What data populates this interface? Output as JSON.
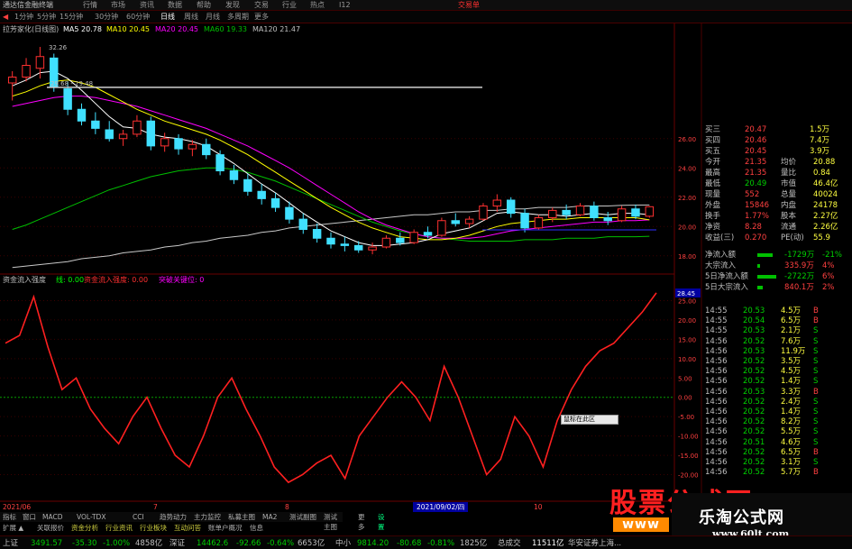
{
  "menubar": {
    "items": [
      "通达信金融终端",
      "行情",
      "市场",
      "资讯",
      "数据",
      "帮助",
      "发现",
      "交易",
      "行业",
      "热点",
      "I12"
    ],
    "trade_button": "交易单",
    "colors": {
      "accent": "#ff2020"
    }
  },
  "toolbar": {
    "period_tabs": [
      "1分钟",
      "5分钟",
      "15分钟",
      "30分钟",
      "60分钟",
      "日线",
      "周线",
      "月线",
      "多周期",
      "更多"
    ],
    "active_period": "日线",
    "icons": [
      "back-icon",
      "refresh-icon"
    ]
  },
  "ma_legend": {
    "stock": "拉芳家化(日线图)",
    "ma5": "MA5 20.78",
    "ma10": "MA10 20.45",
    "ma20": "MA20 20.45",
    "ma60": "MA60 19.33",
    "ma120": "MA120 21.47",
    "colors": {
      "ma5": "#ffffff",
      "ma10": "#ffff00",
      "ma20": "#ff00ff",
      "ma60": "#00c000",
      "ma120": "#c0c0c0"
    }
  },
  "annotations": {
    "high": "32.26",
    "line_label": "29.68 - 29.48",
    "low_right": "28.45"
  },
  "fund_legend": {
    "title": "资金流入强度",
    "value_label": "线: 0.00",
    "signal_label": "资金流入强度: 0.00",
    "extra_label": "突破关键位: 0"
  },
  "quote_panel": {
    "rows": [
      {
        "label": "买三",
        "price": "20.47",
        "vol": "1.5万"
      },
      {
        "label": "买四",
        "price": "20.46",
        "vol": "7.4万"
      },
      {
        "label": "买五",
        "price": "20.45",
        "vol": "3.9万"
      },
      {
        "label": "今开",
        "price": "21.35",
        "label2": "均价",
        "value2": "20.88"
      },
      {
        "label": "最高",
        "price": "21.35",
        "label2": "量比",
        "value2": "0.84"
      },
      {
        "label": "最低",
        "price": "20.49",
        "label2": "市值",
        "value2": "46.4亿"
      },
      {
        "label": "现量",
        "price": "552",
        "label2": "总量",
        "value2": "40024"
      },
      {
        "label": "外盘",
        "price": "15846",
        "label2": "内盘",
        "value2": "24178"
      },
      {
        "label": "换手",
        "price": "1.77%",
        "label2": "股本",
        "value2": "2.27亿"
      },
      {
        "label": "净资",
        "price": "8.28",
        "label2": "流通",
        "value2": "2.26亿"
      },
      {
        "label": "收益(三)",
        "price": "0.270",
        "label2": "PE(动)",
        "value2": "55.9"
      }
    ]
  },
  "flow_panel": {
    "rows": [
      {
        "label": "净流入额",
        "value": "-1729万",
        "pct": "-21%",
        "level": 0.55
      },
      {
        "label": "大宗流入",
        "value": "335.9万",
        "pct": "4%",
        "level": 0.1
      },
      {
        "label": "5日净流入额",
        "value": "-2722万",
        "pct": "6%",
        "level": 0.7
      },
      {
        "label": "5日大宗流入",
        "value": "840.1万",
        "pct": "2%",
        "level": 0.2
      }
    ]
  },
  "ticks": [
    {
      "time": "14:55",
      "price": "20.53",
      "vol": "4.5万",
      "side": "B"
    },
    {
      "time": "14:55",
      "price": "20.54",
      "vol": "6.5万",
      "side": "B"
    },
    {
      "time": "14:55",
      "price": "20.53",
      "vol": "2.1万",
      "side": "S"
    },
    {
      "time": "14:56",
      "price": "20.52",
      "vol": "7.6万",
      "side": "S"
    },
    {
      "time": "14:56",
      "price": "20.53",
      "vol": "11.9万",
      "side": "S"
    },
    {
      "time": "14:56",
      "price": "20.52",
      "vol": "3.5万",
      "side": "S"
    },
    {
      "time": "14:56",
      "price": "20.52",
      "vol": "4.5万",
      "side": "S"
    },
    {
      "time": "14:56",
      "price": "20.52",
      "vol": "1.4万",
      "side": "S"
    },
    {
      "time": "14:56",
      "price": "20.53",
      "vol": "3.3万",
      "side": "B"
    },
    {
      "time": "14:56",
      "price": "20.52",
      "vol": "2.4万",
      "side": "S"
    },
    {
      "time": "14:56",
      "price": "20.52",
      "vol": "1.4万",
      "side": "S"
    },
    {
      "time": "14:56",
      "price": "20.52",
      "vol": "8.2万",
      "side": "S"
    },
    {
      "time": "14:56",
      "price": "20.52",
      "vol": "5.5万",
      "side": "S"
    },
    {
      "time": "14:56",
      "price": "20.51",
      "vol": "4.6万",
      "side": "S"
    },
    {
      "time": "14:56",
      "price": "20.52",
      "vol": "6.5万",
      "side": "B"
    },
    {
      "time": "14:56",
      "price": "20.52",
      "vol": "3.1万",
      "side": "S"
    },
    {
      "time": "14:56",
      "price": "20.52",
      "vol": "5.7万",
      "side": "B"
    }
  ],
  "axis": {
    "main_ticks": [
      "26.00",
      "24.00",
      "22.00",
      "20.00",
      "18.00"
    ],
    "ind_ticks": [
      "25.00",
      "20.00",
      "15.00",
      "10.00",
      "5.00",
      "0.00",
      "-5.00",
      "-10.00",
      "-15.00",
      "-20.00"
    ]
  },
  "date_strip": {
    "left": "2021/06",
    "mid_a": "7",
    "mid_b": "8",
    "selected_date": "2021/09/02/四",
    "right": "10"
  },
  "bottom_tabs": [
    "指标",
    "窗口",
    "MACD",
    "VOL-TDX",
    "CCI",
    "趋势动力",
    "主力监控",
    "私募主图",
    "MA2",
    "测试副图",
    "测试主图",
    "更多",
    "设置"
  ],
  "bottom_tabs2": [
    "扩展 ▲",
    "关联报价",
    "资金分析",
    "行业资讯",
    "行业板块",
    "互动问答",
    "账单户概况",
    "信息"
  ],
  "tooltip": "鼠标在此区",
  "status_bar": {
    "items": [
      {
        "label": "上证",
        "value": "3491.57",
        "change": "-35.30",
        "pct": "-1.00%",
        "amount": "4858亿"
      },
      {
        "label": "深证",
        "value": "14462.6",
        "change": "-92.66",
        "pct": "-0.64%",
        "amount": "6653亿"
      },
      {
        "label": "中小",
        "value": "9814.20",
        "change": "-80.68",
        "pct": "-0.81%",
        "amount": "1825亿"
      }
    ],
    "total_label": "总成交",
    "total_value": "11511亿",
    "broker": "华安证券上海..."
  },
  "watermark": {
    "logo_text": "股票公式网",
    "logo_sub": "www",
    "site_name": "乐淘公式网",
    "site_url": "www.60lt.com"
  },
  "chart_data": {
    "type": "line",
    "candles": [
      {
        "o": 29.8,
        "h": 30.6,
        "l": 28.6,
        "c": 30.2
      },
      {
        "o": 30.2,
        "h": 31.5,
        "l": 29.9,
        "c": 31.0
      },
      {
        "o": 30.8,
        "h": 32.26,
        "l": 30.1,
        "c": 31.6
      },
      {
        "o": 31.5,
        "h": 31.8,
        "l": 29.2,
        "c": 29.5
      },
      {
        "o": 29.4,
        "h": 29.9,
        "l": 27.6,
        "c": 28.0
      },
      {
        "o": 28.0,
        "h": 28.4,
        "l": 26.9,
        "c": 27.2
      },
      {
        "o": 27.2,
        "h": 27.8,
        "l": 26.3,
        "c": 26.7
      },
      {
        "o": 26.6,
        "h": 27.2,
        "l": 25.8,
        "c": 26.0
      },
      {
        "o": 26.0,
        "h": 26.6,
        "l": 25.5,
        "c": 26.3
      },
      {
        "o": 26.3,
        "h": 27.6,
        "l": 26.1,
        "c": 27.2
      },
      {
        "o": 27.2,
        "h": 27.5,
        "l": 25.2,
        "c": 25.5
      },
      {
        "o": 25.5,
        "h": 26.4,
        "l": 25.1,
        "c": 26.0
      },
      {
        "o": 26.0,
        "h": 26.3,
        "l": 24.9,
        "c": 25.3
      },
      {
        "o": 25.3,
        "h": 25.9,
        "l": 24.8,
        "c": 25.6
      },
      {
        "o": 25.6,
        "h": 26.0,
        "l": 24.6,
        "c": 24.9
      },
      {
        "o": 24.9,
        "h": 25.2,
        "l": 23.5,
        "c": 23.8
      },
      {
        "o": 23.8,
        "h": 24.2,
        "l": 22.9,
        "c": 23.2
      },
      {
        "o": 23.2,
        "h": 23.6,
        "l": 22.1,
        "c": 22.4
      },
      {
        "o": 22.4,
        "h": 22.9,
        "l": 21.5,
        "c": 21.9
      },
      {
        "o": 21.9,
        "h": 22.3,
        "l": 21.0,
        "c": 21.3
      },
      {
        "o": 21.3,
        "h": 21.7,
        "l": 20.2,
        "c": 20.5
      },
      {
        "o": 20.5,
        "h": 20.9,
        "l": 19.5,
        "c": 19.8
      },
      {
        "o": 19.8,
        "h": 20.2,
        "l": 18.9,
        "c": 19.2
      },
      {
        "o": 19.2,
        "h": 19.6,
        "l": 18.5,
        "c": 18.8
      },
      {
        "o": 18.8,
        "h": 19.3,
        "l": 18.3,
        "c": 18.7
      },
      {
        "o": 18.7,
        "h": 19.0,
        "l": 18.2,
        "c": 18.4
      },
      {
        "o": 18.4,
        "h": 18.9,
        "l": 18.1,
        "c": 18.6
      },
      {
        "o": 18.6,
        "h": 19.4,
        "l": 18.5,
        "c": 19.2
      },
      {
        "o": 19.2,
        "h": 19.6,
        "l": 18.7,
        "c": 18.9
      },
      {
        "o": 18.9,
        "h": 19.8,
        "l": 18.8,
        "c": 19.6
      },
      {
        "o": 19.6,
        "h": 20.0,
        "l": 19.2,
        "c": 19.4
      },
      {
        "o": 19.4,
        "h": 20.6,
        "l": 19.3,
        "c": 20.4
      },
      {
        "o": 20.4,
        "h": 20.9,
        "l": 20.0,
        "c": 20.2
      },
      {
        "o": 20.2,
        "h": 20.7,
        "l": 19.9,
        "c": 20.5
      },
      {
        "o": 20.5,
        "h": 21.6,
        "l": 20.4,
        "c": 21.4
      },
      {
        "o": 21.4,
        "h": 22.2,
        "l": 21.0,
        "c": 21.8
      },
      {
        "o": 21.8,
        "h": 22.0,
        "l": 20.6,
        "c": 20.9
      },
      {
        "o": 20.9,
        "h": 21.2,
        "l": 19.6,
        "c": 19.9
      },
      {
        "o": 19.9,
        "h": 20.8,
        "l": 19.8,
        "c": 20.6
      },
      {
        "o": 20.6,
        "h": 21.3,
        "l": 20.3,
        "c": 21.1
      },
      {
        "o": 21.1,
        "h": 21.5,
        "l": 20.5,
        "c": 20.8
      },
      {
        "o": 20.8,
        "h": 21.6,
        "l": 20.7,
        "c": 21.4
      },
      {
        "o": 21.4,
        "h": 21.7,
        "l": 20.4,
        "c": 20.6
      },
      {
        "o": 20.6,
        "h": 21.0,
        "l": 20.1,
        "c": 20.4
      },
      {
        "o": 20.4,
        "h": 21.4,
        "l": 20.3,
        "c": 21.2
      },
      {
        "o": 21.2,
        "h": 21.5,
        "l": 20.5,
        "c": 20.7
      },
      {
        "o": 20.7,
        "h": 21.4,
        "l": 20.6,
        "c": 21.35
      }
    ],
    "ma5": [
      29.6,
      30.0,
      30.5,
      30.6,
      30.1,
      29.3,
      28.4,
      27.5,
      26.8,
      26.7,
      26.3,
      26.1,
      26.0,
      25.8,
      25.5,
      24.9,
      24.3,
      23.6,
      22.9,
      22.3,
      21.6,
      20.9,
      20.3,
      19.7,
      19.3,
      18.9,
      18.7,
      18.7,
      18.8,
      18.9,
      19.1,
      19.5,
      19.7,
      19.9,
      20.4,
      20.9,
      21.0,
      20.9,
      20.8,
      20.8,
      20.7,
      20.8,
      20.9,
      20.8,
      20.9,
      20.9,
      20.8
    ],
    "ma10": [
      28.9,
      29.2,
      29.6,
      29.9,
      30.0,
      29.8,
      29.5,
      29.0,
      28.5,
      28.0,
      27.6,
      27.2,
      26.9,
      26.6,
      26.3,
      25.9,
      25.4,
      24.9,
      24.3,
      23.7,
      23.1,
      22.5,
      21.9,
      21.3,
      20.8,
      20.3,
      19.9,
      19.6,
      19.3,
      19.2,
      19.1,
      19.1,
      19.2,
      19.4,
      19.7,
      20.0,
      20.2,
      20.3,
      20.4,
      20.5,
      20.5,
      20.6,
      20.6,
      20.6,
      20.6,
      20.6,
      20.45
    ],
    "ma20": [
      28.2,
      28.4,
      28.6,
      28.8,
      28.9,
      28.9,
      28.8,
      28.6,
      28.4,
      28.2,
      27.9,
      27.6,
      27.3,
      27.0,
      26.7,
      26.3,
      25.9,
      25.5,
      25.0,
      24.5,
      24.0,
      23.4,
      22.8,
      22.2,
      21.6,
      21.0,
      20.5,
      20.1,
      19.8,
      19.5,
      19.3,
      19.2,
      19.2,
      19.2,
      19.3,
      19.5,
      19.7,
      19.8,
      19.9,
      20.0,
      20.1,
      20.2,
      20.3,
      20.3,
      20.4,
      20.4,
      20.45
    ],
    "ma60": [
      19.8,
      20.1,
      20.5,
      20.9,
      21.3,
      21.7,
      22.1,
      22.5,
      22.8,
      23.1,
      23.4,
      23.6,
      23.8,
      23.9,
      24.0,
      24.0,
      23.9,
      23.7,
      23.4,
      23.1,
      22.7,
      22.3,
      21.9,
      21.5,
      21.1,
      20.7,
      20.3,
      20.0,
      19.7,
      19.5,
      19.3,
      19.2,
      19.1,
      19.0,
      19.0,
      19.0,
      19.0,
      19.1,
      19.1,
      19.1,
      19.2,
      19.2,
      19.2,
      19.3,
      19.3,
      19.3,
      19.33
    ],
    "ma120": [
      17.2,
      17.3,
      17.4,
      17.5,
      17.6,
      17.8,
      17.9,
      18.0,
      18.2,
      18.3,
      18.4,
      18.6,
      18.7,
      18.9,
      19.0,
      19.2,
      19.3,
      19.4,
      19.6,
      19.7,
      19.9,
      20.0,
      20.1,
      20.2,
      20.3,
      20.4,
      20.5,
      20.6,
      20.7,
      20.8,
      20.8,
      20.9,
      21.0,
      21.0,
      21.1,
      21.1,
      21.2,
      21.2,
      21.3,
      21.3,
      21.3,
      21.4,
      21.4,
      21.4,
      21.45,
      21.46,
      21.47
    ],
    "fund_flow": {
      "x": [
        "2021/06",
        "",
        "",
        "",
        "",
        "",
        "",
        "",
        "",
        "7",
        "",
        "",
        "",
        "",
        "",
        "",
        "",
        "",
        "",
        "",
        "",
        "",
        "8",
        "",
        "",
        "",
        "",
        "",
        "",
        "",
        "",
        "",
        "2021/09/02",
        "",
        "",
        "",
        "",
        "",
        "",
        "",
        "",
        "",
        "10",
        "",
        "",
        "",
        ""
      ],
      "values": [
        14,
        16,
        26,
        13,
        2,
        5,
        -3,
        -8,
        -12,
        -5,
        0,
        -8,
        -15,
        -18,
        -10,
        0,
        5,
        -3,
        -10,
        -18,
        -22,
        -20,
        -17,
        -15,
        -21,
        -10,
        -5,
        0,
        4,
        0,
        -6,
        8,
        0,
        -10,
        -20,
        -16,
        -5,
        -10,
        -18,
        -6,
        2,
        8,
        12,
        14,
        18,
        22,
        27
      ]
    },
    "ylim_main": [
      17.0,
      33.0
    ],
    "ylim_indicator": [
      -25,
      30
    ]
  }
}
